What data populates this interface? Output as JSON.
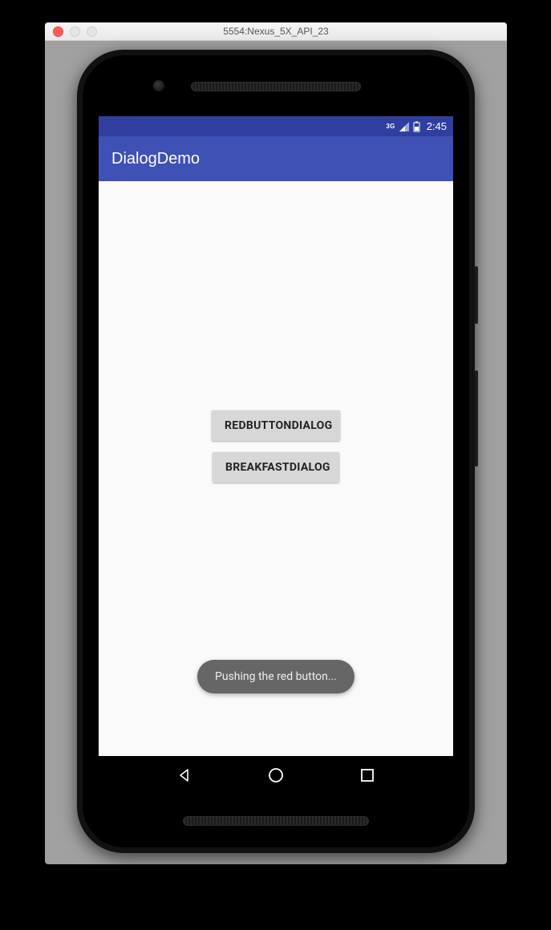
{
  "window": {
    "title": "5554:Nexus_5X_API_23"
  },
  "statusbar": {
    "network_label": "3G",
    "clock": "2:45"
  },
  "appbar": {
    "title": "DialogDemo"
  },
  "buttons": {
    "redbutton_label": "REDBUTTONDIALOG",
    "breakfast_label": "BREAKFASTDIALOG"
  },
  "toast": {
    "message": "Pushing the red button..."
  }
}
